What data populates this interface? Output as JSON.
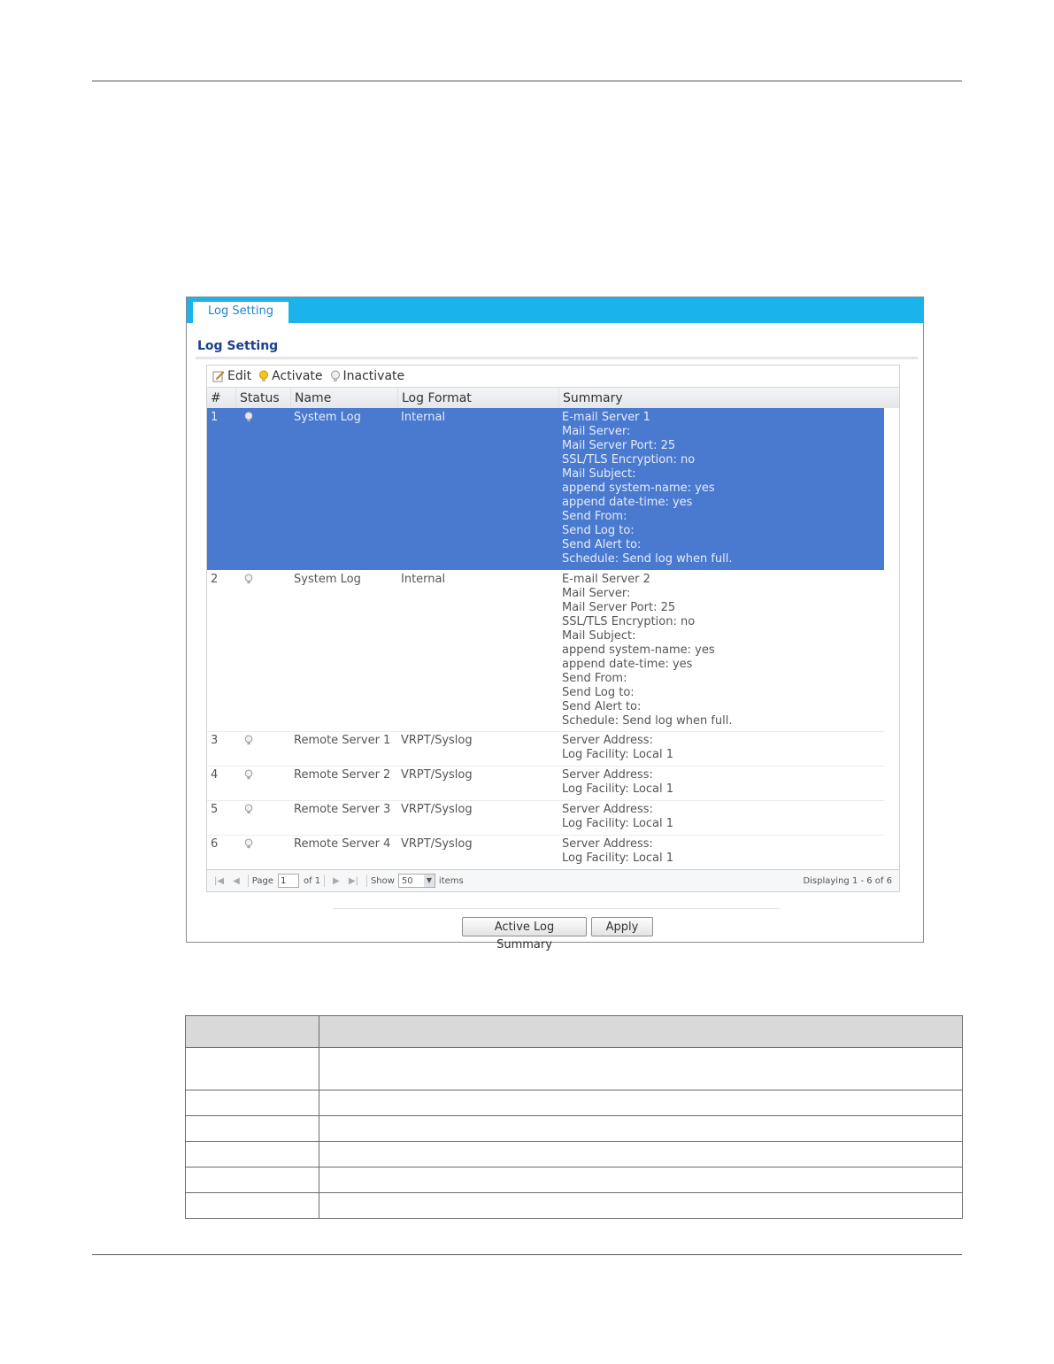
{
  "panel": {
    "tab_label": "Log Setting",
    "section_title": "Log Setting",
    "toolbar": {
      "edit": "Edit",
      "activate": "Activate",
      "inactivate": "Inactivate"
    },
    "columns": {
      "num": "#",
      "status": "Status",
      "name": "Name",
      "format": "Log Format",
      "summary": "Summary"
    },
    "rows": [
      {
        "num": "1",
        "name": "System Log",
        "format": "Internal",
        "selected": true,
        "summary": [
          "E-mail Server 1",
          "Mail Server:",
          "Mail Server Port: 25",
          "SSL/TLS Encryption: no",
          "Mail Subject:",
          "append system-name: yes",
          "append date-time: yes",
          "Send From:",
          "Send Log to:",
          "Send Alert to:",
          "Schedule: Send log when full."
        ]
      },
      {
        "num": "2",
        "name": "System Log",
        "format": "Internal",
        "selected": false,
        "summary": [
          "E-mail Server 2",
          "Mail Server:",
          "Mail Server Port: 25",
          "SSL/TLS Encryption: no",
          "Mail Subject:",
          "append system-name: yes",
          "append date-time: yes",
          "Send From:",
          "Send Log to:",
          "Send Alert to:",
          "Schedule: Send log when full."
        ]
      },
      {
        "num": "3",
        "name": "Remote Server 1",
        "format": "VRPT/Syslog",
        "selected": false,
        "summary": [
          "Server Address:",
          "Log Facility: Local 1"
        ]
      },
      {
        "num": "4",
        "name": "Remote Server 2",
        "format": "VRPT/Syslog",
        "selected": false,
        "summary": [
          "Server Address:",
          "Log Facility: Local 1"
        ]
      },
      {
        "num": "5",
        "name": "Remote Server 3",
        "format": "VRPT/Syslog",
        "selected": false,
        "summary": [
          "Server Address:",
          "Log Facility: Local 1"
        ]
      },
      {
        "num": "6",
        "name": "Remote Server 4",
        "format": "VRPT/Syslog",
        "selected": false,
        "summary": [
          "Server Address:",
          "Log Facility: Local 1"
        ]
      }
    ],
    "pager": {
      "page_label": "Page",
      "page_value": "1",
      "of_label": "of 1",
      "show_label": "Show",
      "show_value": "50",
      "items_label": "items",
      "displaying": "Displaying 1 - 6 of 6"
    },
    "buttons": {
      "active_log_summary": "Active Log Summary",
      "apply": "Apply"
    }
  },
  "colors": {
    "tab_bar": "#1ab4ea",
    "selected_row": "#4a7acf",
    "title": "#1a3f8b"
  },
  "doc_table": {
    "rows": 6
  }
}
